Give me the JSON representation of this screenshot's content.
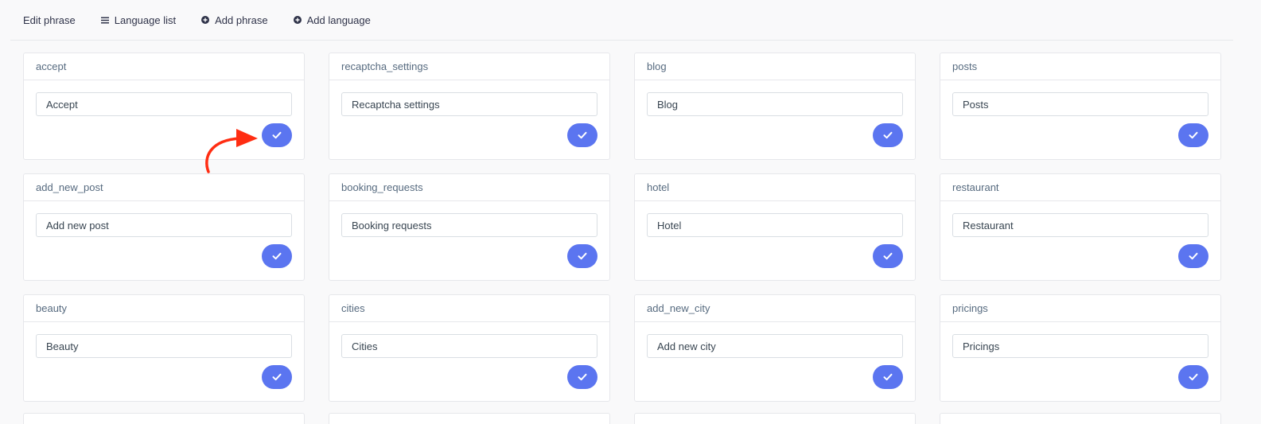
{
  "tabs": [
    {
      "label": "Edit phrase",
      "icon": "none"
    },
    {
      "label": "Language list",
      "icon": "list-icon"
    },
    {
      "label": "Add phrase",
      "icon": "plus-circle-icon"
    },
    {
      "label": "Add language",
      "icon": "plus-circle-icon"
    }
  ],
  "cards": [
    {
      "key": "accept",
      "value": "Accept"
    },
    {
      "key": "recaptcha_settings",
      "value": "Recaptcha settings"
    },
    {
      "key": "blog",
      "value": "Blog"
    },
    {
      "key": "posts",
      "value": "Posts"
    },
    {
      "key": "add_new_post",
      "value": "Add new post"
    },
    {
      "key": "booking_requests",
      "value": "Booking requests"
    },
    {
      "key": "hotel",
      "value": "Hotel"
    },
    {
      "key": "restaurant",
      "value": "Restaurant"
    },
    {
      "key": "beauty",
      "value": "Beauty"
    },
    {
      "key": "cities",
      "value": "Cities"
    },
    {
      "key": "add_new_city",
      "value": "Add new city"
    },
    {
      "key": "pricings",
      "value": "Pricings"
    }
  ],
  "colors": {
    "accent": "#5b75f0",
    "annotation_arrow": "#ff2d12"
  }
}
